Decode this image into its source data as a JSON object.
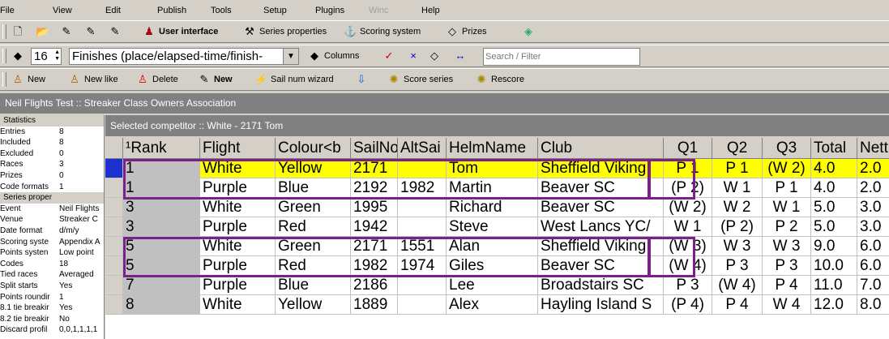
{
  "menu": [
    "File",
    "View",
    "Edit",
    "Publish",
    "Tools",
    "Setup",
    "Plugins",
    "Winc",
    "Help"
  ],
  "toolbar1": {
    "ui_label": "User interface",
    "series_props": "Series properties",
    "scoring": "Scoring system",
    "prizes": "Prizes"
  },
  "toolbar2": {
    "race_num": "16",
    "view_select": "Finishes (place/elapsed-time/finish-",
    "columns": "Columns",
    "search_placeholder": "Search / Filter"
  },
  "toolbar3": {
    "new": "New",
    "new_like": "New like",
    "delete": "Delete",
    "new2": "New",
    "sailnum": "Sail num wizard",
    "score": "Score series",
    "rescore": "Rescore"
  },
  "window_title": "Neil Flights Test :: Streaker Class Owners Association",
  "selected": "Selected competitor :: White - 2171 Tom",
  "stats": {
    "header": "Statistics",
    "rows": [
      [
        "Entries",
        "8"
      ],
      [
        "Included",
        "8"
      ],
      [
        "Excluded",
        "0"
      ],
      [
        "Races",
        "3"
      ],
      [
        "Prizes",
        "0"
      ],
      [
        "Code formats",
        "1"
      ]
    ]
  },
  "props": {
    "header": "Series proper",
    "rows": [
      [
        "Event",
        "Neil Flights"
      ],
      [
        "Venue",
        "Streaker C"
      ],
      [
        "Date format",
        "d/m/y"
      ],
      [
        "Scoring syste",
        "Appendix A"
      ],
      [
        "Points systen",
        "Low point"
      ],
      [
        "Codes",
        "18"
      ],
      [
        "Tied races",
        "Averaged"
      ],
      [
        "Split starts",
        "Yes"
      ],
      [
        "Points roundir",
        "1"
      ],
      [
        "8.1 tie breakir",
        "Yes"
      ],
      [
        "8.2 tie breakir",
        "No"
      ],
      [
        "Discard profil",
        "0,0,1,1,1,1"
      ]
    ]
  },
  "columns": [
    "¹Rank",
    "Flight",
    "Colour<b",
    "SailNo",
    "AltSai",
    "HelmName",
    "Club",
    "Q1",
    "Q2",
    "Q3",
    "Total",
    "Nett"
  ],
  "rows": [
    [
      "1",
      "White",
      "Yellow",
      "2171",
      "",
      "Tom",
      "Sheffield Viking",
      "P 1",
      "P 1",
      "(W 2)",
      "4.0",
      "2.0"
    ],
    [
      "1",
      "Purple",
      "Blue",
      "2192",
      "1982",
      "Martin",
      "Beaver SC",
      "(P 2)",
      "W 1",
      "P 1",
      "4.0",
      "2.0"
    ],
    [
      "3",
      "White",
      "Green",
      "1995",
      "",
      "Richard",
      "Beaver SC",
      "(W 2)",
      "W 2",
      "W 1",
      "5.0",
      "3.0"
    ],
    [
      "3",
      "Purple",
      "Red",
      "1942",
      "",
      "Steve",
      "West Lancs YC/",
      "W 1",
      "(P 2)",
      "P 2",
      "5.0",
      "3.0"
    ],
    [
      "5",
      "White",
      "Green",
      "2171",
      "1551",
      "Alan",
      "Sheffield Viking",
      "(W 3)",
      "W 3",
      "W 3",
      "9.0",
      "6.0"
    ],
    [
      "5",
      "Purple",
      "Red",
      "1982",
      "1974",
      "Giles",
      "Beaver SC",
      "(W 4)",
      "P 3",
      "P 3",
      "10.0",
      "6.0"
    ],
    [
      "7",
      "Purple",
      "Blue",
      "2186",
      "",
      "Lee",
      "Broadstairs SC",
      "P 3",
      "(W 4)",
      "P 4",
      "11.0",
      "7.0"
    ],
    [
      "8",
      "White",
      "Yellow",
      "1889",
      "",
      "Alex",
      "Hayling Island S",
      "(P 4)",
      "P 4",
      "W 4",
      "12.0",
      "8.0"
    ]
  ],
  "colors": {
    "selected_row": "#ffff00",
    "highlight_box": "#7b1f8a"
  }
}
